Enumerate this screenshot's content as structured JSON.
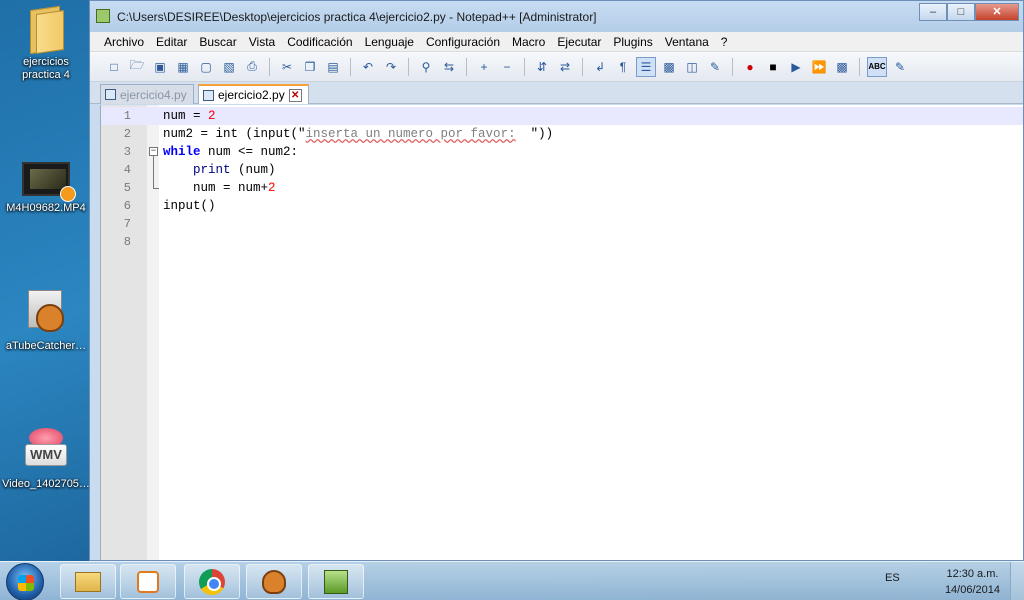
{
  "desktop": {
    "icons": [
      {
        "label": "ejercicios\npractica 4",
        "icon": "folder-icon"
      },
      {
        "label": "M4H09682.MP4",
        "icon": "video-file-icon"
      },
      {
        "label": "aTubeCatcher…",
        "icon": "atubecatcher-icon"
      },
      {
        "label": "Video_1402705…",
        "icon": "wmv-file-icon"
      }
    ],
    "icon0_line1": "ejercicios",
    "icon0_line2": "practica 4"
  },
  "window": {
    "title": "C:\\Users\\DESIREE\\Desktop\\ejercicios practica 4\\ejercicio2.py - Notepad++ [Administrator]",
    "buttons": {
      "minimize": "–",
      "maximize": "□",
      "close": "✕"
    }
  },
  "menu": [
    "Archivo",
    "Editar",
    "Buscar",
    "Vista",
    "Codificación",
    "Lenguaje",
    "Configuración",
    "Macro",
    "Ejecutar",
    "Plugins",
    "Ventana",
    "?"
  ],
  "tabs": [
    {
      "label": "ejercicio4.py",
      "active": false
    },
    {
      "label": "ejercicio2.py",
      "active": true
    }
  ],
  "editor": {
    "line_numbers": [
      "1",
      "2",
      "3",
      "4",
      "5",
      "6",
      "7",
      "8"
    ],
    "current_line": 1,
    "code": {
      "l1_a": "num = ",
      "l1_num": "2",
      "l2_a": "num2 = int (input(\"",
      "l2_str": "inserta un numero por favor:",
      "l2_b": "  \"))",
      "l3_kw": "while",
      "l3_b": " num <= num2:",
      "l4_indent": "    ",
      "l4_kw": "print",
      "l4_b": " (num)",
      "l5_a": "    num = num+",
      "l5_num": "2",
      "l6_a": "input()"
    }
  },
  "taskbar": {
    "apps": [
      "file-explorer",
      "media-player",
      "google-chrome",
      "atubecatcher",
      "notepad-plus-plus"
    ],
    "language": "ES",
    "time": "12:30 a.m.",
    "date": "14/06/2014"
  }
}
